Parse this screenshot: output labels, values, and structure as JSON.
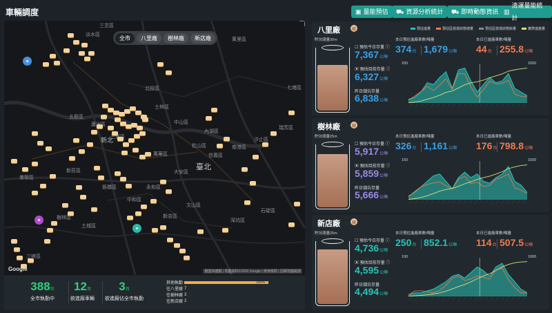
{
  "header": {
    "title": "車輛調度",
    "buttons": [
      {
        "label": "量能預估",
        "icon": "calendar-icon"
      },
      {
        "label": "資源分析統計",
        "icon": "car-icon"
      },
      {
        "label": "即時動態資訊",
        "icon": "truck-icon"
      },
      {
        "label": "清運量能統計",
        "icon": "bar-chart-icon"
      }
    ]
  },
  "map": {
    "chips": [
      "全市",
      "八里廠",
      "樹林廠",
      "新店廠"
    ],
    "active_chip": "全市",
    "google": "Google",
    "credit": "鍵盤快捷鍵 | 地圖資料©2020 Google | 使用條款 | 回報地圖錯誤",
    "places": [
      {
        "name": "淡水區"
      },
      {
        "name": "三芝區"
      },
      {
        "name": "萬里區"
      },
      {
        "name": "北投區"
      },
      {
        "name": "士林區"
      },
      {
        "name": "汐止區"
      },
      {
        "name": "內湖區"
      },
      {
        "name": "中山區"
      },
      {
        "name": "新莊區"
      },
      {
        "name": "板橋區"
      },
      {
        "name": "大安區"
      },
      {
        "name": "臺北"
      },
      {
        "name": "新店區"
      },
      {
        "name": "文山區"
      },
      {
        "name": "土城區"
      },
      {
        "name": "三峽區"
      },
      {
        "name": "樹林區"
      },
      {
        "name": "三重區"
      },
      {
        "name": "深坑區"
      },
      {
        "name": "石碇區"
      },
      {
        "name": "五股區"
      },
      {
        "name": "蘆洲區"
      },
      {
        "name": "新北"
      },
      {
        "name": "鶯歌區"
      },
      {
        "name": "中和區"
      },
      {
        "name": "永和區"
      },
      {
        "name": "萬華區"
      },
      {
        "name": "信義區"
      },
      {
        "name": "松山區"
      },
      {
        "name": "南港區"
      },
      {
        "name": "七堵區"
      },
      {
        "name": "瑞芳區"
      }
    ]
  },
  "stats": {
    "items": [
      {
        "value": "388",
        "unit": "台",
        "label": "全市執勤中"
      },
      {
        "value": "12",
        "unit": "台",
        "label": "欲進廠車輛"
      },
      {
        "value": "3",
        "unit": "台",
        "label": "欲進廠佔全市執勤"
      }
    ],
    "legend": [
      {
        "key": "其他執勤",
        "value": "0",
        "bar": "100%"
      },
      {
        "key": "往八里廠",
        "value": "7"
      },
      {
        "key": "往樹林廠",
        "value": "3"
      },
      {
        "key": "往新店廠",
        "value": "2"
      }
    ]
  },
  "legend_labels": [
    "預估進量",
    "預估區營運狀態總量",
    "預估區營運狀態餘量",
    "實際進廠量"
  ],
  "factories": [
    {
      "name": "八里廠",
      "badge": "廠",
      "tank_label": "貯坑總量30m",
      "m1_label": "預估今日存量",
      "m1": "7,367",
      "m2_label": "預估目前存量",
      "m2": "6,327",
      "m3_label": "昨日儲坑存量",
      "m3": "6,838",
      "unit": "公噸",
      "h1": "本日預估進廠車數/噸量",
      "h2": "本日已進廠車數/噸量",
      "est_cars": "374",
      "est_tons": "1,679",
      "act_cars": "44",
      "act_tons": "255.8",
      "unit_car": "台",
      "fill_pct": 0.72,
      "y_left_max": "200",
      "y_right_max": "2000"
    },
    {
      "name": "樹林廠",
      "badge": "廠",
      "tank_label": "貯坑總量25m",
      "m1_label": "預估今日存量",
      "m1": "5,917",
      "m2_label": "預估目前存量",
      "m2": "5,859",
      "m3_label": "昨日儲坑存量",
      "m3": "5,666",
      "unit": "公噸",
      "h1": "本日預估進廠車數/噸量",
      "h2": "本日已進廠車數/噸量",
      "est_cars": "326",
      "est_tons": "1,161",
      "act_cars": "176",
      "act_tons": "798.8",
      "unit_car": "台",
      "fill_pct": 0.84,
      "y_left_max": "150",
      "y_right_max": "1500"
    },
    {
      "name": "新店廠",
      "badge": "廠",
      "tank_label": "貯坑總量25m",
      "m1_label": "預估今日存量",
      "m1": "4,736",
      "m2_label": "預估目前存量",
      "m2": "4,595",
      "m3_label": "昨日儲坑存量",
      "m3": "4,494",
      "unit": "公噸",
      "h1": "本日預估進廠車數/噸量",
      "h2": "本日已進廠車數/噸量",
      "est_cars": "250",
      "est_tons": "852.1",
      "act_cars": "114",
      "act_tons": "507.5",
      "unit_car": "台",
      "fill_pct": 0.86,
      "y_left_max": "100",
      "y_right_max": "1000"
    }
  ],
  "colors": {
    "accent": "#1f9c8f",
    "green": "#2fd07d",
    "orange": "#f07a52",
    "teal": "#29c3b7",
    "purple": "#9b88e8",
    "blue": "#3aa0e6"
  }
}
